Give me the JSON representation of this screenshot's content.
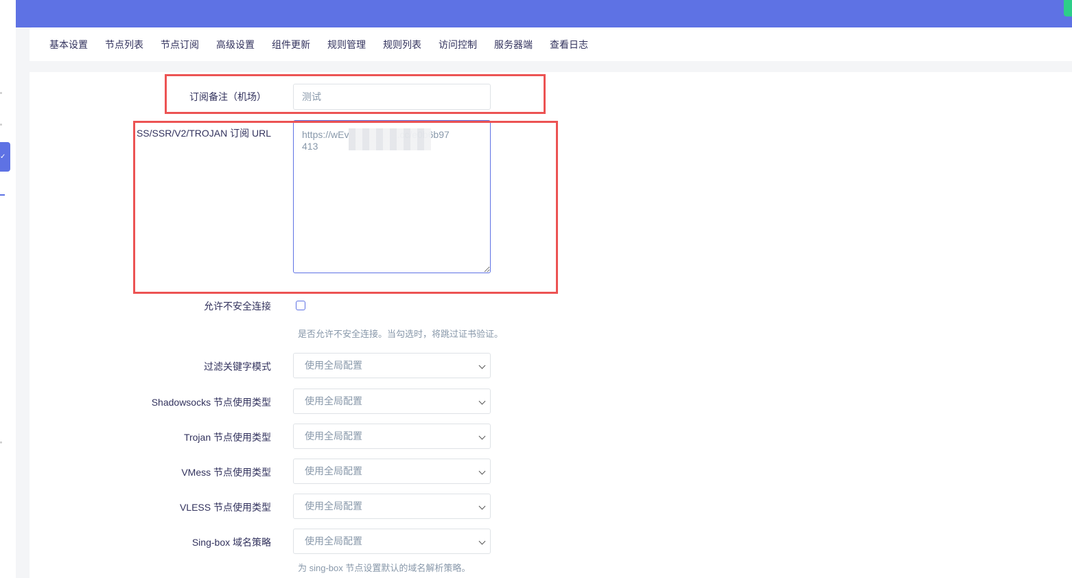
{
  "tabs": [
    "基本设置",
    "节点列表",
    "节点订阅",
    "高级设置",
    "组件更新",
    "规则管理",
    "规则列表",
    "访问控制",
    "服务器端",
    "查看日志"
  ],
  "form": {
    "remark_label": "订阅备注（机场）",
    "remark_value": "测试",
    "url_label": "SS/SSR/V2/TROJAN 订阅 URL",
    "url_value": "https://wEv                  .cc/e0b6b97\n413",
    "insecure_label": "允许不安全连接",
    "insecure_help": "是否允许不安全连接。当勾选时，将跳过证书验证。",
    "insecure_checked": false,
    "selects": [
      {
        "label": "过滤关键字模式",
        "value": "使用全局配置"
      },
      {
        "label": "Shadowsocks 节点使用类型",
        "value": "使用全局配置"
      },
      {
        "label": "Trojan 节点使用类型",
        "value": "使用全局配置"
      },
      {
        "label": "VMess 节点使用类型",
        "value": "使用全局配置"
      },
      {
        "label": "VLESS 节点使用类型",
        "value": "使用全局配置"
      },
      {
        "label": "Sing-box 域名策略",
        "value": "使用全局配置"
      }
    ],
    "singbox_help": "为 sing-box 节点设置默认的域名解析策略。"
  },
  "colors": {
    "accent": "#5e72e4",
    "highlight": "#ec5353",
    "green": "#2dce89"
  }
}
